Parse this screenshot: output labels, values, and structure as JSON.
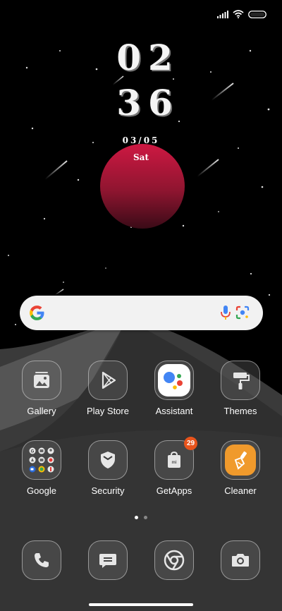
{
  "clock": {
    "hours": "02",
    "minutes": "36"
  },
  "date": {
    "date_text": "03/05",
    "day_text": "Sat"
  },
  "search": {
    "placeholder": ""
  },
  "apps_row1": [
    {
      "label": "Gallery",
      "icon": "gallery-icon"
    },
    {
      "label": "Play Store",
      "icon": "play-store-icon"
    },
    {
      "label": "Assistant",
      "icon": "assistant-icon"
    },
    {
      "label": "Themes",
      "icon": "themes-icon"
    }
  ],
  "apps_row2": [
    {
      "label": "Google",
      "icon": "google-folder-icon"
    },
    {
      "label": "Security",
      "icon": "security-icon"
    },
    {
      "label": "GetApps",
      "icon": "getapps-icon",
      "badge": "29"
    },
    {
      "label": "Cleaner",
      "icon": "cleaner-icon"
    }
  ],
  "dock": [
    {
      "icon": "phone-icon"
    },
    {
      "icon": "messages-icon"
    },
    {
      "icon": "chrome-icon"
    },
    {
      "icon": "camera-icon"
    }
  ],
  "page_indicator": {
    "pages": 2,
    "current": 1
  },
  "colors": {
    "planet_top": "#c4153e",
    "planet_bottom": "#3e0c18",
    "badge": "#e8541c",
    "cleaner_accent": "#f09a2c",
    "assistant_blue": "#4285f4",
    "assistant_red": "#ea4335",
    "assistant_yellow": "#fbbc05",
    "assistant_green": "#34a853"
  }
}
